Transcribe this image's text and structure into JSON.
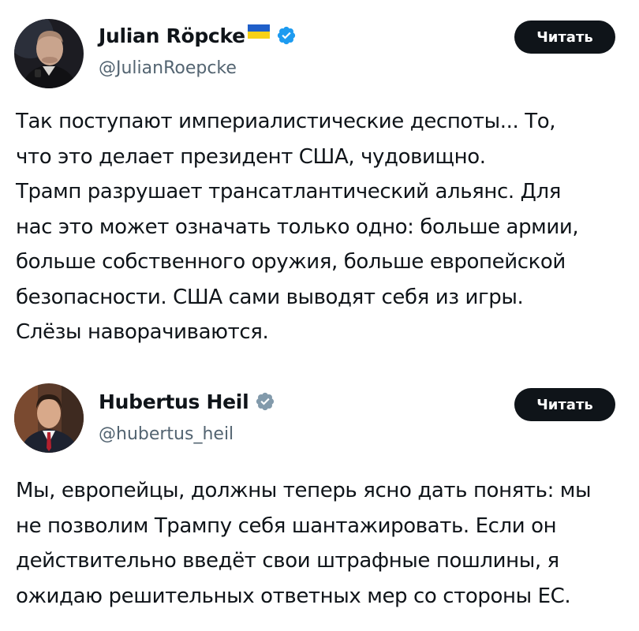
{
  "tweets": [
    {
      "display_name": "Julian Röpcke",
      "has_flag": true,
      "flag_colors": [
        "#1f5fc9",
        "#f7d117"
      ],
      "verified_icon": "verified-badge-icon",
      "verified_color": "#1d9bf0",
      "handle": "@JulianRoepcke",
      "button_label": "Читать",
      "text_lines": [
        "Так поступают империалистические деспоты... То,",
        "что это делает президент США, чудовищно.",
        "Трамп разрушает трансатлантический альянс. Для",
        "нас это может означать только одно: больше армии,",
        "больше собственного оружия, больше европейской",
        "безопасности. США сами выводят себя из игры.",
        "Слёзы наворачиваются."
      ]
    },
    {
      "display_name": "Hubertus Heil",
      "has_flag": false,
      "verified_icon": "verified-badge-icon",
      "verified_color": "#829aab",
      "handle": "@hubertus_heil",
      "button_label": "Читать",
      "text_lines": [
        "Мы, европейцы, должны теперь ясно дать понять: мы",
        "не позволим Трампу себя шантажировать. Если он",
        "действительно введёт свои штрафные пошлины, я",
        "ожидаю решительных ответных мер со стороны ЕС."
      ]
    }
  ],
  "colors": {
    "text": "#0f1419",
    "secondary": "#536471",
    "button_bg": "#0f1419",
    "button_text": "#ffffff"
  }
}
